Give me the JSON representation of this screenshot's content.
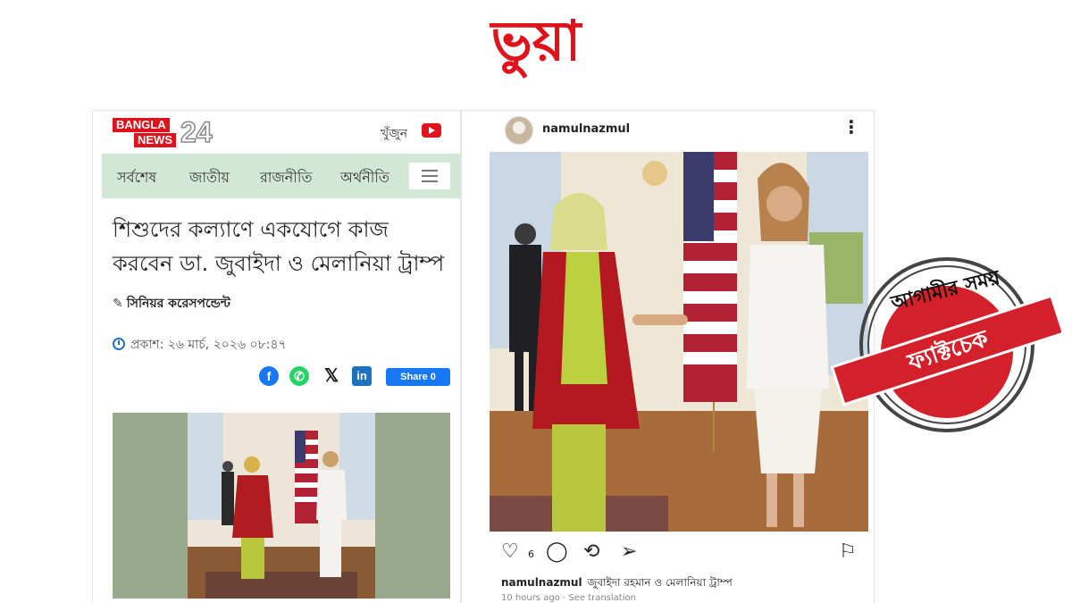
{
  "verdict": "ভুয়া",
  "news": {
    "logo": {
      "line1": "BANGLA",
      "line2": "NEWS",
      "num": "24"
    },
    "search_label": "খুঁজুন",
    "nav": [
      "সর্বশেষ",
      "জাতীয়",
      "রাজনীতি",
      "অর্থনীতি"
    ],
    "headline": "শিশুদের কল্যাণে একযোগে কাজ করবেন ডা. জুবাইদা ও মেলানিয়া ট্রাম্প",
    "byline": "সিনিয়র করেসপন্ডেন্ট",
    "published": "প্রকাশ: ২৬ মার্চ, ২০২৬ ০৮:৪৭",
    "share_button": "Share 0",
    "share_icons": [
      "facebook-icon",
      "whatsapp-icon",
      "x-icon",
      "linkedin-icon"
    ]
  },
  "insta": {
    "username": "namulnazmul",
    "like_count": "6",
    "caption_user": "namulnazmul",
    "caption_text": "জুবাইদা রহমান ও মেলানিয়া ট্রাম্প",
    "time": "10 hours ago",
    "see_translation": "See translation"
  },
  "stamp": {
    "arc_text": "আগামীর সময়",
    "ribbon_text": "ফ্যাক্টচেক"
  },
  "colors": {
    "red": "#e0121c",
    "nav_bg": "#d2e8d6",
    "facebook": "#1877f2",
    "whatsapp": "#25d366",
    "stamp_red": "#d3202a"
  }
}
